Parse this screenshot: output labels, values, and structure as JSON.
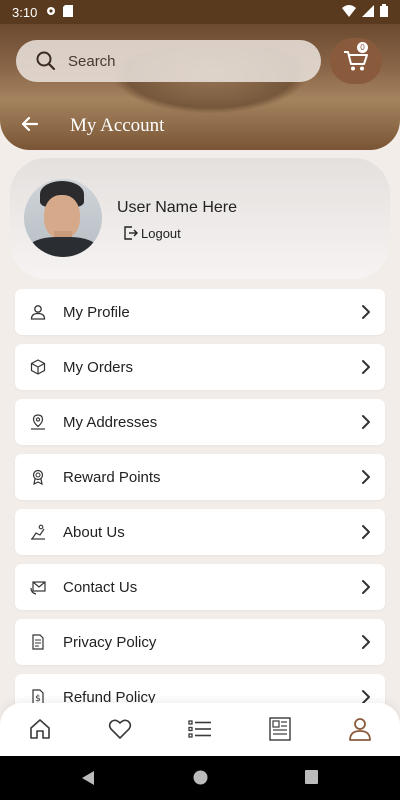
{
  "status_bar": {
    "time": "3:10"
  },
  "header": {
    "search_placeholder": "Search",
    "cart_count": "0",
    "title": "My Account"
  },
  "profile": {
    "user_name": "User Name Here",
    "logout_label": "Logout"
  },
  "menu": {
    "items": [
      {
        "label": "My Profile",
        "icon": "person-icon"
      },
      {
        "label": "My Orders",
        "icon": "orders-box-icon"
      },
      {
        "label": "My Addresses",
        "icon": "location-pin-icon"
      },
      {
        "label": "Reward Points",
        "icon": "reward-medal-icon"
      },
      {
        "label": "About Us",
        "icon": "about-info-icon"
      },
      {
        "label": "Contact Us",
        "icon": "contact-mail-icon"
      },
      {
        "label": "Privacy Policy",
        "icon": "privacy-document-icon"
      },
      {
        "label": "Refund Policy",
        "icon": "refund-dollar-icon"
      }
    ]
  },
  "bottom_nav": {
    "items": [
      "home-icon",
      "heart-icon",
      "list-icon",
      "news-icon",
      "account-icon"
    ],
    "active": "account-icon",
    "accent_color": "#8a5a3c"
  },
  "colors": {
    "brand_brown": "#5a3a1e",
    "background": "#f3ede9"
  }
}
